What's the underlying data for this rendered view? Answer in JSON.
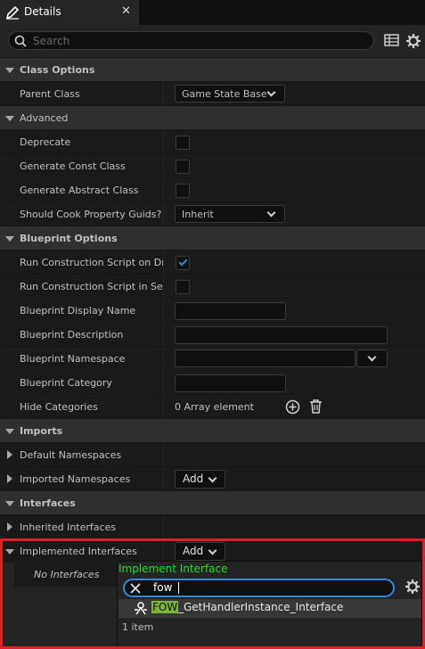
{
  "tab": {
    "title": "Details",
    "close": "✕",
    "icon": "pencil-icon"
  },
  "search": {
    "placeholder": "Search"
  },
  "toolbar": {
    "icons": [
      "table-view-icon",
      "gear-icon"
    ]
  },
  "categories": {
    "class_options": "Class Options",
    "advanced": "Advanced",
    "blueprint_options": "Blueprint Options",
    "imports": "Imports",
    "interfaces": "Interfaces"
  },
  "class_options": {
    "parent_class": {
      "label": "Parent Class",
      "value": "Game State Base"
    }
  },
  "advanced": {
    "deprecate": {
      "label": "Deprecate",
      "checked": false
    },
    "generate_const_class": {
      "label": "Generate Const Class",
      "checked": false
    },
    "generate_abstract_class": {
      "label": "Generate Abstract Class",
      "checked": false
    },
    "cook_guids": {
      "label": "Should Cook Property Guids?",
      "value": "Inherit"
    }
  },
  "blueprint_options": {
    "run_construction_drag": {
      "label": "Run Construction Script on Drag",
      "checked": true
    },
    "run_construction_seq": {
      "label": "Run Construction Script in Seq...",
      "checked": false
    },
    "display_name": {
      "label": "Blueprint Display Name",
      "value": ""
    },
    "description": {
      "label": "Blueprint Description",
      "value": ""
    },
    "namespace": {
      "label": "Blueprint Namespace",
      "value": ""
    },
    "category": {
      "label": "Blueprint Category",
      "value": ""
    },
    "hide_categories": {
      "label": "Hide Categories",
      "value": "0 Array element"
    }
  },
  "imports": {
    "default_namespaces": "Default Namespaces",
    "imported_namespaces": {
      "label": "Imported Namespaces",
      "button": "Add"
    }
  },
  "interfaces": {
    "inherited": "Inherited Interfaces",
    "implemented": {
      "label": "Implemented Interfaces",
      "button": "Add"
    },
    "none_label": "No Interfaces"
  },
  "popup": {
    "title": "Implement Interface",
    "search_value": "fow",
    "result_highlight": "FOW",
    "result_rest": "_GetHandlerInstance_Interface",
    "count": "1 item"
  },
  "colors": {
    "accent": "#2e8bdc",
    "popup_title": "#1fe31f",
    "highlight": "#7bb63a",
    "annotation_box": "#e21f26"
  }
}
